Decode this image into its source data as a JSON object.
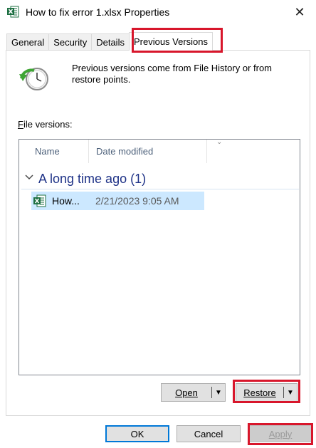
{
  "window": {
    "title": "How to fix error 1.xlsx Properties",
    "close_glyph": "✕"
  },
  "tabs": [
    {
      "label": "General"
    },
    {
      "label": "Security"
    },
    {
      "label": "Details"
    },
    {
      "label": "Previous Versions",
      "active": true
    }
  ],
  "panel": {
    "info_text": "Previous versions come from File History or from restore points.",
    "file_versions_label_first": "F",
    "file_versions_label_rest": "ile versions:"
  },
  "list": {
    "columns": [
      "Name",
      "Date modified"
    ],
    "group": {
      "title": "A long time ago (1)"
    },
    "rows": [
      {
        "name": "How...",
        "date_modified": "2/21/2023 9:05 AM",
        "icon": "excel-file-icon"
      }
    ]
  },
  "buttons": {
    "open": "Open",
    "restore": "Restore",
    "ok": "OK",
    "cancel": "Cancel",
    "apply": "Apply"
  },
  "colors": {
    "highlight": "#d8162b",
    "selection": "#cce8ff",
    "group_title": "#1e3287",
    "default_button_border": "#0078d7"
  }
}
